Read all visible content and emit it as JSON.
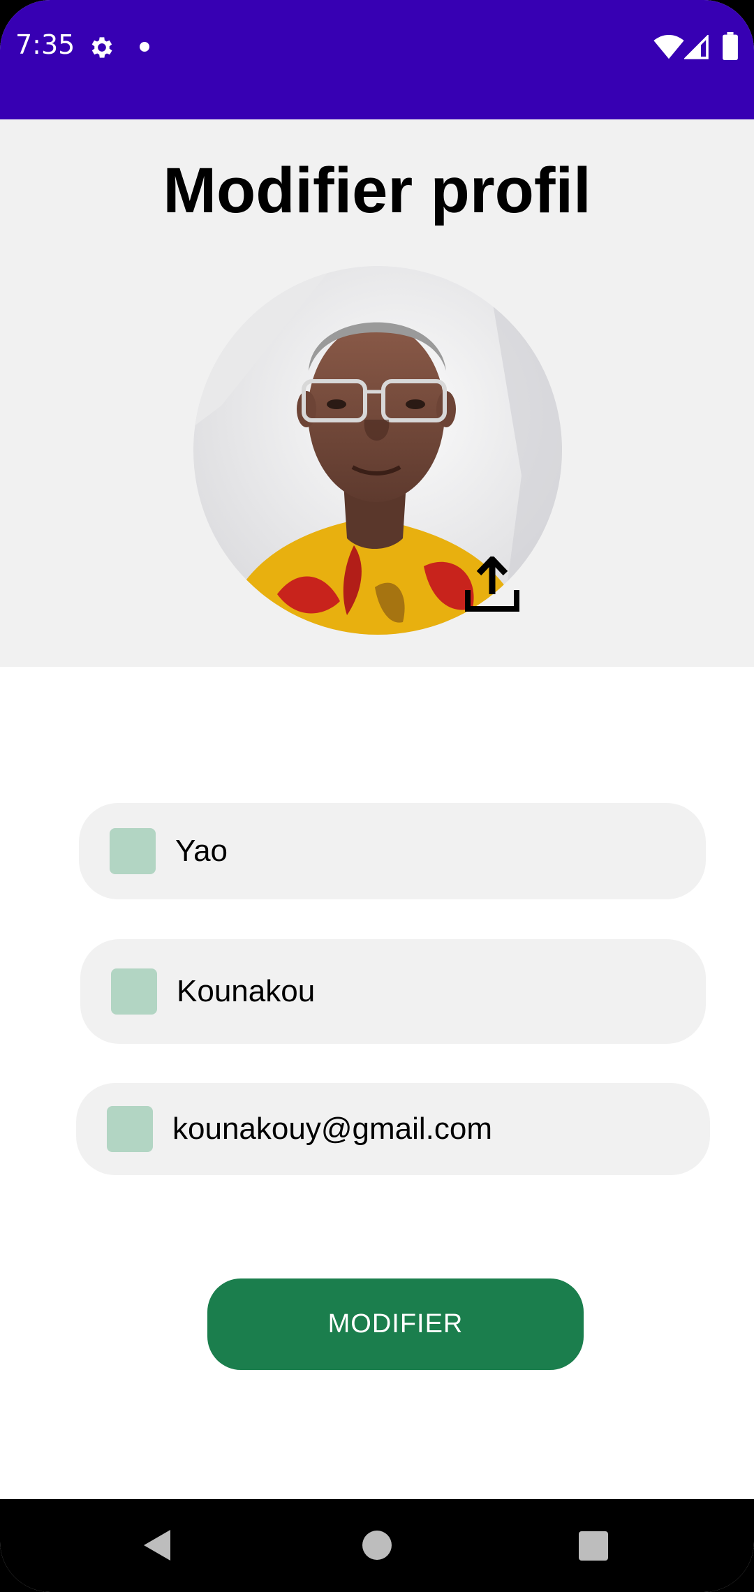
{
  "status_bar": {
    "time": "7:35",
    "icons": [
      "gear-icon",
      "notification-dot-icon",
      "wifi-icon",
      "signal-icon",
      "battery-icon"
    ],
    "background_color": "#3700b3"
  },
  "header": {
    "title": "Modifier profil",
    "avatar_icon": "upload-icon"
  },
  "form": {
    "first_name": {
      "value": "Yao",
      "icon": "person-icon"
    },
    "last_name": {
      "value": "Kounakou",
      "icon": "person-icon"
    },
    "email": {
      "value": "kounakouy@gmail.com",
      "icon": "email-icon"
    },
    "submit_label": "MODIFIER"
  },
  "colors": {
    "accent": "#1b7e4d",
    "field_background": "#f1f1f1",
    "field_icon": "#b2d5c3"
  },
  "nav_bar": {
    "icons": [
      "back-icon",
      "home-icon",
      "recents-icon"
    ]
  }
}
